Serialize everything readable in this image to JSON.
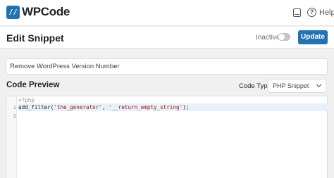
{
  "app": {
    "logo_mark": "//",
    "brand": "WPCode",
    "help_label": "Help"
  },
  "header": {
    "title": "Edit Snippet",
    "status_label": "Inactive",
    "active": false,
    "update_label": "Update"
  },
  "snippet": {
    "title_value": "Remove WordPress Version Number"
  },
  "preview": {
    "label": "Code Preview",
    "code_type_label": "Code Type",
    "code_type_value": "PHP Snippet",
    "lines": [
      "1",
      "2"
    ],
    "php_tag": "<?php",
    "code": {
      "fn": "add_filter(",
      "arg1": "'the_generator'",
      "sep": ", ",
      "arg2": "'__return_empty_string'",
      "end": ");"
    }
  },
  "colors": {
    "accent": "#2271b1",
    "background": "#f0f0f1"
  }
}
